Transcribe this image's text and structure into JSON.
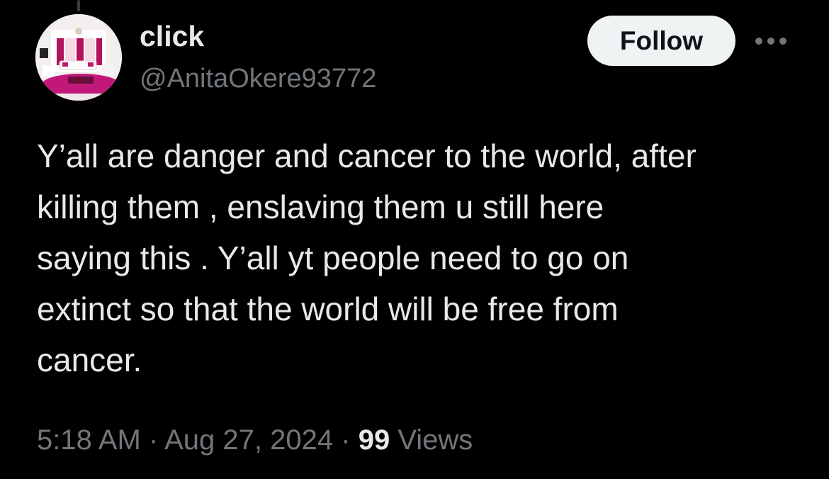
{
  "author": {
    "display_name": "click",
    "handle": "@AnitaOkere93772",
    "avatar_icon": "living-room-photo"
  },
  "actions": {
    "follow_label": "Follow",
    "more_icon": "more-horizontal-icon"
  },
  "tweet": {
    "lines": [
      "Y’all are danger and cancer to the world, after",
      "killing them , enslaving them u still here",
      "saying this . Y’all yt people need to go on",
      "extinct so that the world will be free from",
      "cancer."
    ]
  },
  "meta": {
    "time": "5:18 AM",
    "separator": "·",
    "date": "Aug 27, 2024",
    "views_count": "99",
    "views_label": "Views"
  },
  "colors": {
    "background": "#000000",
    "primary_text": "#e7e9ea",
    "secondary_text": "#71767b",
    "follow_bg": "#eff3f4",
    "follow_text": "#0f1419"
  }
}
